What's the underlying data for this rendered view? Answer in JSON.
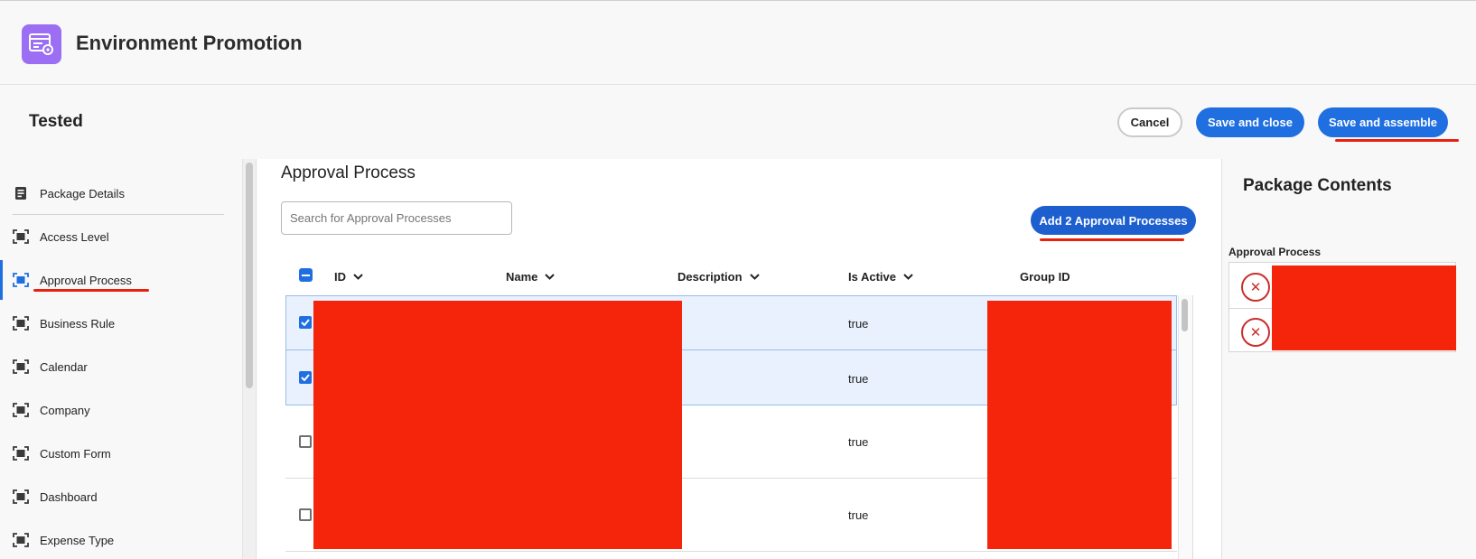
{
  "header": {
    "app_title": "Environment Promotion",
    "app_icon": "environment-promotion-icon"
  },
  "package": {
    "name": "Tested",
    "cancel_label": "Cancel",
    "save_close_label": "Save and close",
    "save_assemble_label": "Save and assemble"
  },
  "sidebar": {
    "items": [
      {
        "label": "Package Details",
        "icon": "document-list-icon"
      },
      {
        "label": "Access Level",
        "icon": "frame-icon"
      },
      {
        "label": "Approval Process",
        "icon": "frame-icon",
        "selected": true
      },
      {
        "label": "Business Rule",
        "icon": "frame-icon"
      },
      {
        "label": "Calendar",
        "icon": "frame-icon"
      },
      {
        "label": "Company",
        "icon": "frame-icon"
      },
      {
        "label": "Custom Form",
        "icon": "frame-icon"
      },
      {
        "label": "Dashboard",
        "icon": "frame-icon"
      },
      {
        "label": "Expense Type",
        "icon": "frame-icon"
      }
    ]
  },
  "main": {
    "title": "Approval Process",
    "search_placeholder": "Search for Approval Processes",
    "add_button_label": "Add 2 Approval Processes",
    "columns": [
      "ID",
      "Name",
      "Description",
      "Is Active",
      "Group ID"
    ],
    "rows": [
      {
        "checked": true,
        "is_active": "true"
      },
      {
        "checked": true,
        "is_active": "true"
      },
      {
        "checked": false,
        "is_active": "true"
      },
      {
        "checked": false,
        "is_active": "true"
      }
    ]
  },
  "package_contents": {
    "title": "Package Contents",
    "section_label": "Approval Process",
    "item_count": 2
  },
  "colors": {
    "accent": "#1f6fe0",
    "redaction": "#f5250b",
    "annotation": "#e8200d",
    "app_icon_bg": "#9b6ef3"
  }
}
